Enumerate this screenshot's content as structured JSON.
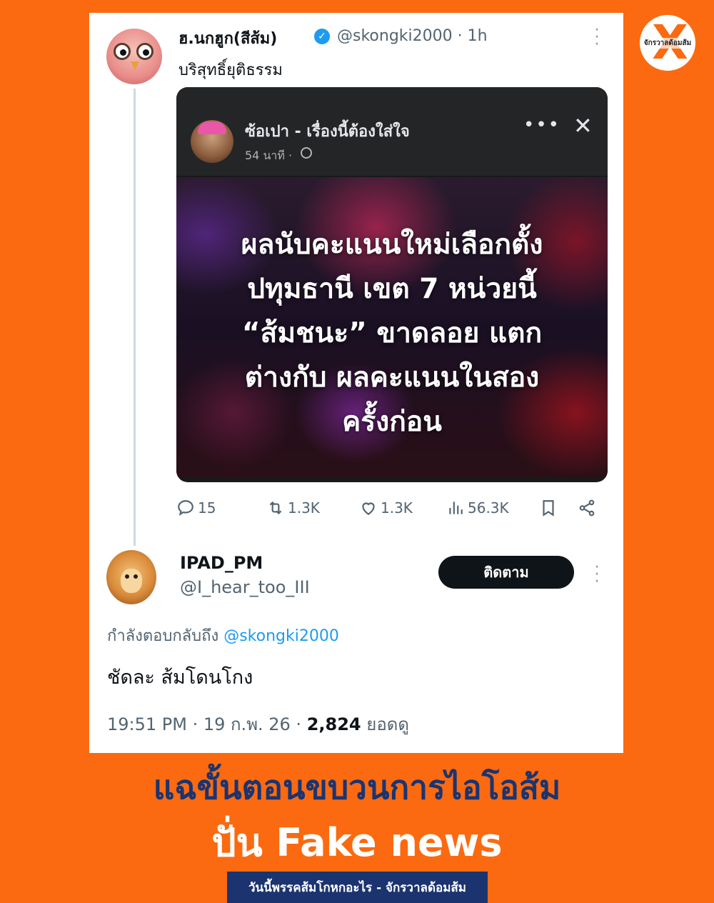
{
  "logo": {
    "text": "จักรวาลด้อมส้ม",
    "mark": "X"
  },
  "tweet": {
    "display_name": "ฮ.นกฮูก(สีส้ม)",
    "verified_icon": "verified-badge-icon",
    "handle": "@skongki2000",
    "time": "· 1h",
    "text": "บริสุทธิ์ยุติธรรม",
    "embedded_post": {
      "page_name": "ซ้อเปา - เรื่องนี้ต้องใส่ใจ",
      "time": "54 นาที ·",
      "headline_lines": [
        "ผลนับคะแนนใหม่เลือกตั้ง",
        "ปทุมธานี เขต 7 หน่วยนี้",
        "“ส้มชนะ” ขาดลอย แตก",
        "ต่างกับ ผลคะแนนในสอง",
        "ครั้งก่อน"
      ]
    },
    "actions": {
      "replies": "15",
      "retweets": "1.3K",
      "likes": "1.3K",
      "views": "56.3K"
    }
  },
  "reply": {
    "display_name": "IPAD_PM",
    "handle": "@I_hear_too_III",
    "follow_label": "ติดตาม",
    "replying_to_prefix": "กำลังตอบกลับถึง",
    "replying_to_handle": "@skongki2000",
    "text": "ชัดละ ส้มโดนโกง",
    "timestamp": "19:51 PM · 19 ก.พ. 26 ·",
    "views_count": "2,824",
    "views_label": "ยอดดู"
  },
  "caption": {
    "line1": "แฉขั้นตอนขบวนการไอโอส้ม",
    "line2": "ปั่น Fake news"
  },
  "footer": "วันนี้พรรคส้มโกหกอะไร - จักรวาลด้อมส้ม",
  "colors": {
    "background": "#fb6a10",
    "caption_dark": "#1b3470",
    "link": "#1d9bf0",
    "verified": "#1d9bf0"
  }
}
